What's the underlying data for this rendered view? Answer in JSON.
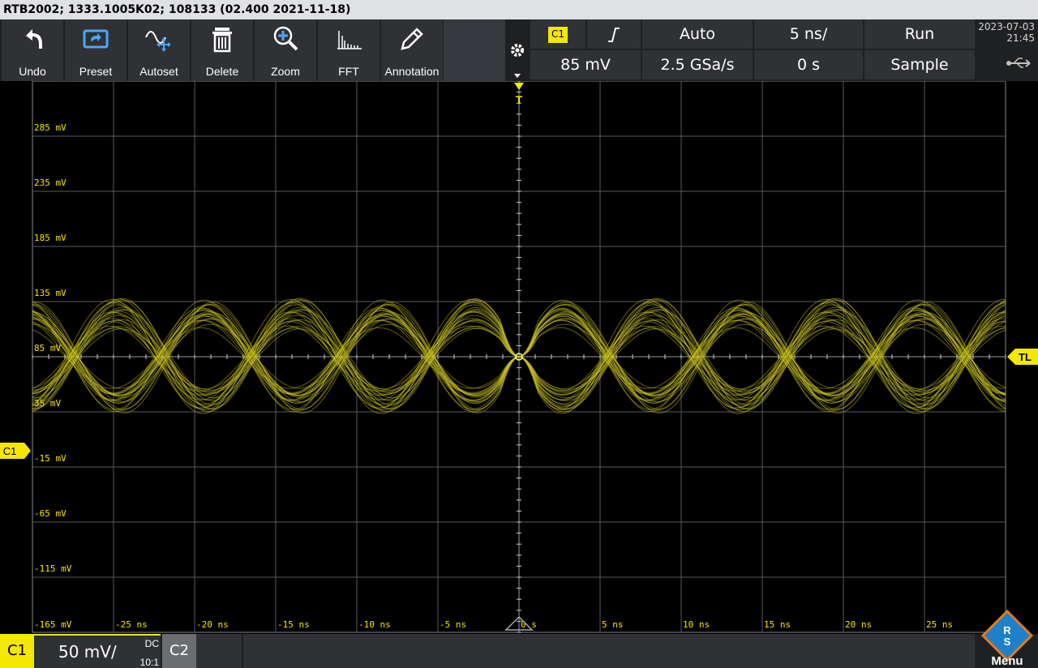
{
  "title": "RTB2002; 1333.1005K02; 108133 (02.400 2021-11-18)",
  "toolbar": [
    {
      "label": "Undo",
      "icon": "undo-icon"
    },
    {
      "label": "Preset",
      "icon": "preset-icon"
    },
    {
      "label": "Autoset",
      "icon": "autoset-icon"
    },
    {
      "label": "Delete",
      "icon": "delete-icon"
    },
    {
      "label": "Zoom",
      "icon": "zoom-icon"
    },
    {
      "label": "FFT",
      "icon": "fft-icon"
    },
    {
      "label": "Annotation",
      "icon": "annotation-icon"
    }
  ],
  "trigger": {
    "source": "C1",
    "slope_icon": "rising-edge-icon",
    "level": "85 mV",
    "mode": "Auto"
  },
  "timebase": {
    "scale": "5 ns/",
    "position": "0 s"
  },
  "acquisition": {
    "sample_rate": "2.5 GSa/s",
    "run_state": "Run",
    "mode": "Sample"
  },
  "datetime": {
    "date": "2023-07-03",
    "time": "21:45"
  },
  "channel": {
    "name": "C1",
    "scale": "50 mV/",
    "coupling": "DC",
    "probe": "10:1",
    "marker": "C1"
  },
  "channel2": {
    "name": "C2"
  },
  "markers": {
    "trigger_top": "T",
    "trigger_level": "TL"
  },
  "brand": {
    "menu_label": "Menu",
    "logo_text": "R S",
    "color": "#1e80c8"
  },
  "colors": {
    "trace": "#c8c020",
    "c1": "#f2e800",
    "grid": "#5a5a5a",
    "tick": "#cfcfcf"
  },
  "chart_data": {
    "type": "line",
    "title": "",
    "xlabel": "",
    "ylabel": "",
    "xlim": [
      -30,
      30
    ],
    "ylim": [
      -165,
      335
    ],
    "x_ticks": [
      "-25 ns",
      "-20 ns",
      "-15 ns",
      "-10 ns",
      "-5 ns",
      "0 s",
      "5 ns",
      "10 ns",
      "15 ns",
      "20 ns",
      "25 ns"
    ],
    "x_tick_values": [
      -25,
      -20,
      -15,
      -10,
      -5,
      0,
      5,
      10,
      15,
      20,
      25
    ],
    "y_ticks": [
      "285 mV",
      "235 mV",
      "185 mV",
      "135 mV",
      "85 mV",
      "35 mV",
      "-15 mV",
      "-65 mV",
      "-115 mV",
      "-165 mV"
    ],
    "y_tick_values": [
      285,
      235,
      185,
      135,
      85,
      35,
      -15,
      -65,
      -115,
      -165
    ],
    "grid": true,
    "series": [
      {
        "period_ns": 11,
        "amplitude_mv": 50,
        "offset_mv": 85,
        "phase": "rising through trigger at 0 s",
        "persistence": true
      },
      {
        "period_ns": 11,
        "amplitude_mv": 50,
        "offset_mv": 85,
        "phase": "falling through trigger at 0 s",
        "persistence": true
      }
    ]
  }
}
